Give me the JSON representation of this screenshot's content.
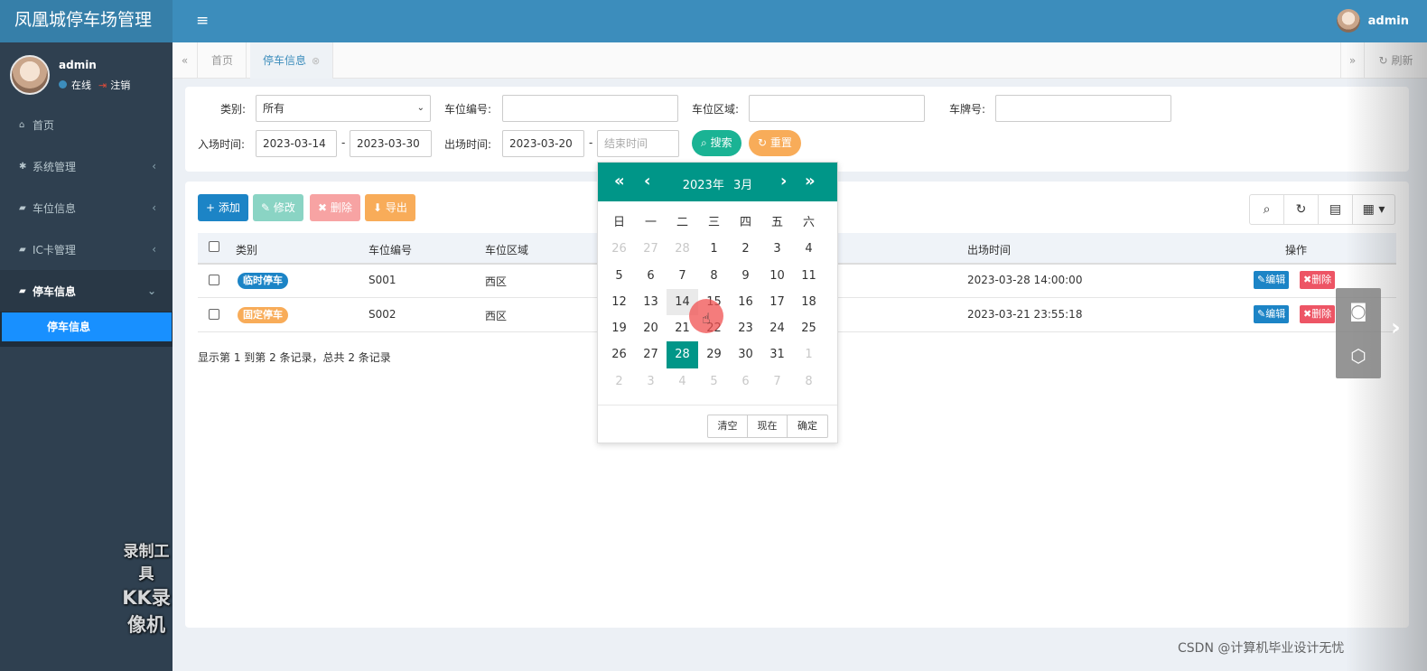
{
  "app": {
    "title": "凤凰城停车场管理",
    "top_user": "admin",
    "colors": {
      "brand": "#367fa9",
      "topbar": "#3c8dbc",
      "sidebar": "#2f4050",
      "accent": "#1890ff",
      "datepicker": "#009688"
    }
  },
  "sidebar": {
    "user": {
      "name": "admin",
      "status": "在线",
      "logout": "注销"
    },
    "items": [
      {
        "icon": "home-icon",
        "label": "首页"
      },
      {
        "icon": "gear-icon",
        "label": "系统管理"
      },
      {
        "icon": "book-icon",
        "label": "车位信息"
      },
      {
        "icon": "book-icon",
        "label": "IC卡管理"
      },
      {
        "icon": "book-icon",
        "label": "停车信息"
      }
    ],
    "sub_active": "停车信息",
    "watermark": [
      "录制工具",
      "KK录像机"
    ]
  },
  "tabs": {
    "items": [
      "首页",
      "停车信息"
    ],
    "refresh": "刷新"
  },
  "search": {
    "category_label": "类别:",
    "category_value": "所有",
    "space_no_label": "车位编号:",
    "area_label": "车位区域:",
    "plate_label": "车牌号:",
    "entry_label": "入场时间:",
    "entry_from": "2023-03-14",
    "entry_to": "2023-03-30",
    "exit_label": "出场时间:",
    "exit_from": "2023-03-20",
    "exit_to_placeholder": "结束时间",
    "dash": "-",
    "search_btn": "搜索",
    "reset_btn": "重置"
  },
  "toolbar": {
    "add": "添加",
    "edit": "修改",
    "delete": "删除",
    "export": "导出"
  },
  "table": {
    "headers": [
      "类别",
      "车位编号",
      "车位区域",
      "出场时间",
      "操作"
    ],
    "rows": [
      {
        "type": "临时停车",
        "type_color": "#1c84c6",
        "space": "S001",
        "area": "西区",
        "exit": "2023-03-28 14:00:00"
      },
      {
        "type": "固定停车",
        "type_color": "#f8ac59",
        "space": "S002",
        "area": "西区",
        "exit": "2023-03-21 23:55:18"
      }
    ],
    "action_edit": "编辑",
    "action_delete": "删除",
    "footer": "显示第 1 到第 2 条记录，总共 2 条记录"
  },
  "datepicker": {
    "year_label": "2023年",
    "month_label": "3月",
    "weekdays": [
      "日",
      "一",
      "二",
      "三",
      "四",
      "五",
      "六"
    ],
    "days": [
      [
        "26",
        "o"
      ],
      [
        "27",
        "o"
      ],
      [
        "28",
        "o"
      ],
      [
        "1",
        ""
      ],
      [
        "2",
        ""
      ],
      [
        "3",
        ""
      ],
      [
        "4",
        ""
      ],
      [
        "5",
        ""
      ],
      [
        "6",
        ""
      ],
      [
        "7",
        ""
      ],
      [
        "8",
        ""
      ],
      [
        "9",
        ""
      ],
      [
        "10",
        ""
      ],
      [
        "11",
        ""
      ],
      [
        "12",
        ""
      ],
      [
        "13",
        ""
      ],
      [
        "14",
        "hover"
      ],
      [
        "15",
        ""
      ],
      [
        "16",
        ""
      ],
      [
        "17",
        ""
      ],
      [
        "18",
        ""
      ],
      [
        "19",
        ""
      ],
      [
        "20",
        ""
      ],
      [
        "21",
        ""
      ],
      [
        "22",
        ""
      ],
      [
        "23",
        ""
      ],
      [
        "24",
        ""
      ],
      [
        "25",
        ""
      ],
      [
        "26",
        ""
      ],
      [
        "27",
        ""
      ],
      [
        "28",
        "sel"
      ],
      [
        "29",
        ""
      ],
      [
        "30",
        ""
      ],
      [
        "31",
        ""
      ],
      [
        "1",
        "o"
      ],
      [
        "2",
        "o"
      ],
      [
        "3",
        "o"
      ],
      [
        "4",
        "o"
      ],
      [
        "5",
        "o"
      ],
      [
        "6",
        "o"
      ],
      [
        "7",
        "o"
      ],
      [
        "8",
        "o"
      ]
    ],
    "clear": "清空",
    "now": "现在",
    "ok": "确定"
  },
  "credit": "CSDN @计算机毕业设计无忧"
}
